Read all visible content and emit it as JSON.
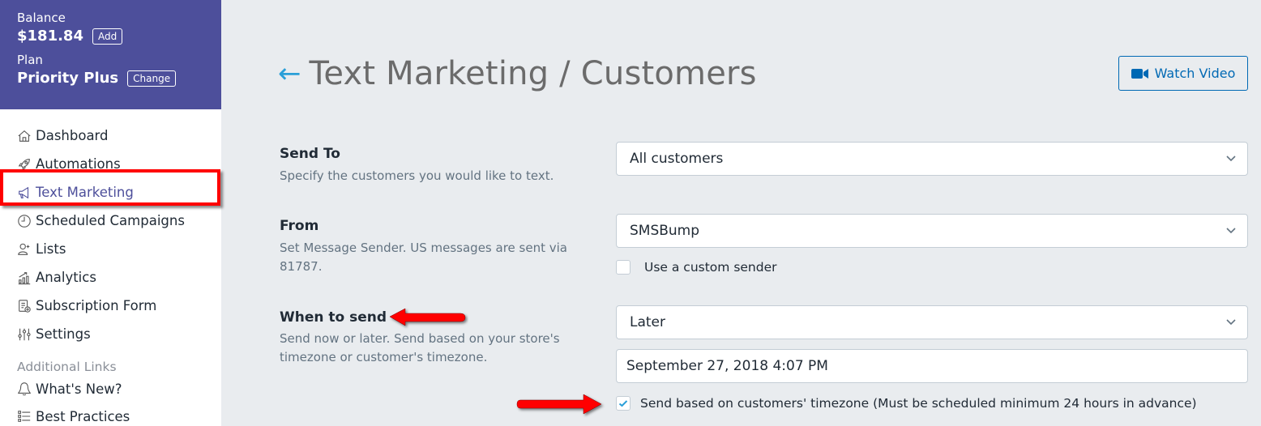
{
  "account": {
    "balance_label": "Balance",
    "balance_value": "$181.84",
    "add_button": "Add",
    "plan_label": "Plan",
    "plan_value": "Priority Plus",
    "change_button": "Change",
    "header_color": "#4d4f9b"
  },
  "sidebar": {
    "items": [
      {
        "label": "Dashboard",
        "icon": "home-icon"
      },
      {
        "label": "Automations",
        "icon": "rocket-icon"
      },
      {
        "label": "Text Marketing",
        "icon": "megaphone-icon",
        "active": true
      },
      {
        "label": "Scheduled Campaigns",
        "icon": "clock-icon"
      },
      {
        "label": "Lists",
        "icon": "user-add-icon"
      },
      {
        "label": "Analytics",
        "icon": "chart-icon"
      },
      {
        "label": "Subscription Form",
        "icon": "form-icon"
      },
      {
        "label": "Settings",
        "icon": "sliders-icon"
      }
    ],
    "section_label": "Additional Links",
    "additional": [
      {
        "label": "What's New?",
        "icon": "bell-icon"
      },
      {
        "label": "Best Practices",
        "icon": "list-icon"
      }
    ]
  },
  "header": {
    "back_icon": "arrow-left-icon",
    "title": "Text Marketing / Customers",
    "watch_video": "Watch Video"
  },
  "form": {
    "send_to": {
      "label": "Send To",
      "help": "Specify the customers you would like to text.",
      "value": "All customers"
    },
    "from": {
      "label": "From",
      "help": "Set Message Sender. US messages are sent via 81787.",
      "value": "SMSBump",
      "custom_sender_label": "Use a custom sender",
      "custom_sender_checked": false
    },
    "when": {
      "label": "When to send",
      "help": "Send now or later. Send based on your store's timezone or customer's timezone.",
      "value": "Later",
      "datetime": "September 27, 2018 4:07 PM",
      "timezone_label": "Send based on customers' timezone (Must be scheduled minimum 24 hours in advance)",
      "timezone_checked": true
    }
  },
  "colors": {
    "accent": "#0069b4",
    "back_arrow": "#2a9fd8",
    "annotation": "#ff0000",
    "background": "#e9ecef"
  }
}
